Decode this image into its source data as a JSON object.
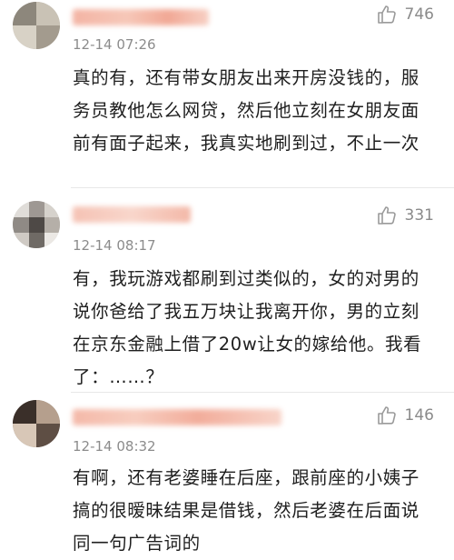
{
  "comments": [
    {
      "likes": "746",
      "time": "12-14 07:26",
      "text": "真的有，还有带女朋友出来开房没钱的，服务员教他怎么网贷，然后他立刻在女朋友面前有面子起来，我真实地刷到过，不止一次"
    },
    {
      "likes": "331",
      "time": "12-14 08:17",
      "text": "有，我玩游戏都刷到过类似的，女的对男的说你爸给了我五万块让我离开你，男的立刻在京东金融上借了20w让女的嫁给他。我看了：……？"
    },
    {
      "likes": "146",
      "time": "12-14 08:32",
      "text": "有啊，还有老婆睡在后座，跟前座的小姨子搞的很暧昧结果是借钱，然后老婆在后面说同一句广告词的"
    }
  ],
  "icons": {
    "like": "thumbs-up-icon"
  }
}
